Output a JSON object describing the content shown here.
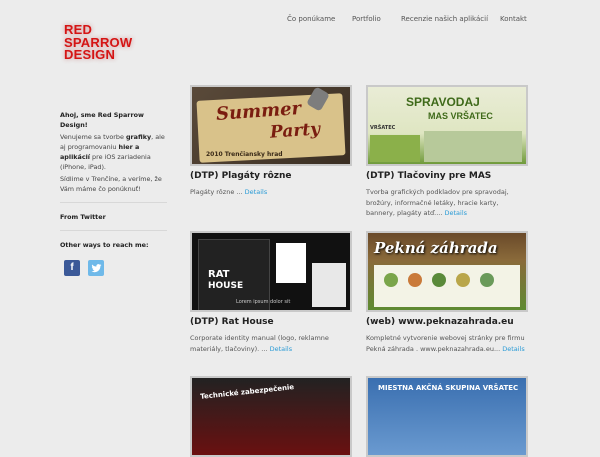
{
  "logo": {
    "lines": [
      "RED",
      "SPARROW",
      "DESIGN"
    ]
  },
  "nav": {
    "items": [
      "Čo ponúkame",
      "Portfolio",
      "Recenzie našich aplikácií",
      "Kontakt"
    ]
  },
  "sidebar": {
    "greeting": "Ahoj, sme Red Sparrow Design!",
    "intro_1": "Venujeme sa tvorbe ",
    "intro_bold_1": "grafiky",
    "intro_2": ", ale aj programovaniu ",
    "intro_bold_2": "hier a aplikácií",
    "intro_3": " pre iOS zariadenia (iPhone, iPad).",
    "location_text": "Sídlime v Trenčíne, a veríme, že Vám máme čo ponúknuť!",
    "twitter_heading": "From Twitter",
    "reach_heading": "Other ways to reach me:",
    "social": [
      "facebook-icon",
      "twitter-icon"
    ]
  },
  "cards": [
    {
      "title": "(DTP) Plagáty rôzne",
      "desc": "Plagáty rôzne ...",
      "more": "Details",
      "thumb_text": {
        "line1": "Summer",
        "line2": "Party",
        "footer": "2010 Trenčiansky hrad"
      }
    },
    {
      "title": "(DTP) Tlačoviny pre MAS",
      "desc": "Tvorba grafických podkladov pre spravodaj, brožúry, informačné letáky, hracie karty, bannery, plagáty atď....",
      "more": "Details",
      "thumb_text": {
        "line1": "SPRAVODAJ",
        "line2": "MAS VRŠATEC",
        "corner": "VRŠATEC"
      }
    },
    {
      "title": "(DTP) Rat House",
      "desc": "Corporate identity manual (logo, reklamne materiály, tlačoviny). ...",
      "more": "Details",
      "thumb_text": {
        "line1": "RAT",
        "line2": "HOUSE",
        "footer": "Lorem ipsum dolor sit"
      }
    },
    {
      "title": "(web) www.peknazahrada.eu",
      "desc": "Kompletné vytvorenie webovej stránky pre firmu Pekná záhrada . www.peknazahrada.eu...",
      "more": "Details",
      "thumb_text": {
        "line1": "Pekná záhrada"
      }
    },
    {
      "title": "",
      "desc": "",
      "more": "",
      "thumb_text": {
        "line1": "Technické zabezpečenie"
      }
    },
    {
      "title": "",
      "desc": "",
      "more": "",
      "thumb_text": {
        "line1": "MIESTNA AKČNÁ SKUPINA VRŠATEC"
      }
    }
  ],
  "colors": {
    "accent": "#2a9bd6",
    "logo": "#d51414",
    "background": "#ececec"
  }
}
